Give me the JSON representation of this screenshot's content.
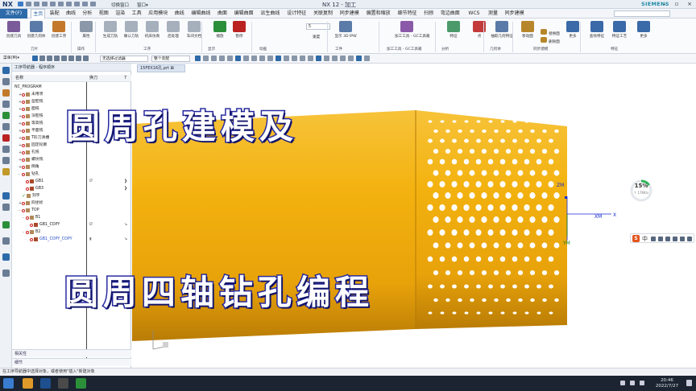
{
  "app": {
    "logo": "NX",
    "title": "NX 12 - 加工",
    "brand": "SIEMENS",
    "switch_window": "切换窗口",
    "window_menu": "窗口▾"
  },
  "menu": {
    "file": "文件(F)",
    "tabs": [
      "主页",
      "装配",
      "曲线",
      "分析",
      "视图",
      "渲染",
      "工具",
      "应用模块",
      "曲线",
      "编辑曲线",
      "曲面",
      "编辑曲面",
      "派生曲线",
      "设计特征",
      "关联复制",
      "同步建模",
      "偏置和缩放",
      "细节特征",
      "扫掠",
      "弯边曲面",
      "WCS",
      "测量",
      "同步建模"
    ]
  },
  "ribbon": {
    "buttons": [
      {
        "label": "创建刀具",
        "color": "#7b5a9a"
      },
      {
        "label": "创建几何体",
        "color": "#5a7aa8"
      },
      {
        "label": "创建工序",
        "color": "#c27a2a"
      },
      {
        "label": "属性",
        "color": "#8a98aa"
      },
      {
        "label": "生成刀轨",
        "color": "#a6b0bd"
      },
      {
        "label": "确认刀轨",
        "color": "#a6b0bd"
      },
      {
        "label": "机床仿真",
        "color": "#a6b0bd"
      },
      {
        "label": "后处理",
        "color": "#a6b0bd"
      },
      {
        "label": "车间文档",
        "color": "#a6b0bd"
      },
      {
        "label": "播放",
        "color": "#2b8f3a"
      },
      {
        "label": "暂停",
        "color": "#b22"
      },
      {
        "label": "显示 3D IPW",
        "color": "#5a7aa8"
      },
      {
        "label": "加工工具 - GC工具箱",
        "color": "#8a5aa8"
      },
      {
        "label": "特征",
        "color": "#4a9a6a"
      },
      {
        "label": "点",
        "color": "#c23a3a"
      },
      {
        "label": "抽取几何特征",
        "color": "#5a7aa8"
      },
      {
        "label": "移动面",
        "color": "#b8862a"
      },
      {
        "label": "替换面",
        "color": "#b8862a"
      },
      {
        "label": "删除面",
        "color": "#b8862a"
      },
      {
        "label": "更多",
        "color": "#3a6aa8"
      },
      {
        "label": "查找特征",
        "color": "#3a6aa8"
      },
      {
        "label": "特征工艺",
        "color": "#3a6aa8"
      },
      {
        "label": "更多",
        "color": "#3a6aa8"
      }
    ],
    "groups": [
      "刀片",
      "操作",
      "工序",
      "显示",
      "动画",
      "工件",
      "加工工具 - GC工具箱",
      "分析",
      "几何体",
      "同步建模",
      "特征"
    ],
    "speed_value": "5",
    "speed_label": "速度"
  },
  "toolbar2": {
    "menu_label": "菜单(M)▾",
    "filter": "无选择过滤器",
    "assembly": "整个装配"
  },
  "navigator": {
    "title": "工序导航器 - 程序顺序",
    "col_name": "名称",
    "col_tool": "换刀",
    "col_path": "7",
    "rows": [
      {
        "indent": 0,
        "name": "NC_PROGRAM",
        "type": "root"
      },
      {
        "indent": 1,
        "name": "未用项",
        "type": "folder",
        "exp": "+"
      },
      {
        "indent": 1,
        "name": "型腔铣",
        "type": "folder",
        "exp": "+"
      },
      {
        "indent": 1,
        "name": "面铣",
        "type": "folder",
        "exp": "+"
      },
      {
        "indent": 1,
        "name": "深腔铣",
        "type": "folder",
        "exp": "+"
      },
      {
        "indent": 1,
        "name": "等高铣",
        "type": "folder",
        "exp": "+"
      },
      {
        "indent": 1,
        "name": "平面铣",
        "type": "folder",
        "exp": "+"
      },
      {
        "indent": 1,
        "name": "T形刀清槽",
        "type": "folder",
        "exp": "+"
      },
      {
        "indent": 1,
        "name": "固定轮廓",
        "type": "folder",
        "exp": "+"
      },
      {
        "indent": 1,
        "name": "孔铣",
        "type": "folder",
        "exp": "+"
      },
      {
        "indent": 1,
        "name": "螺纹铣",
        "type": "folder",
        "exp": "+"
      },
      {
        "indent": 1,
        "name": "倒角",
        "type": "folder",
        "exp": "+"
      },
      {
        "indent": 1,
        "name": "钻孔",
        "type": "folder",
        "exp": "-"
      },
      {
        "indent": 2,
        "name": "GB1",
        "type": "op",
        "tool": "Ø",
        "mark": "❯"
      },
      {
        "indent": 2,
        "name": "GB3",
        "type": "op",
        "tool": "",
        "mark": "❯"
      },
      {
        "indent": 1,
        "name": "刻字",
        "type": "done",
        "exp": ""
      },
      {
        "indent": 1,
        "name": "四坐标",
        "type": "folder",
        "exp": "+"
      },
      {
        "indent": 1,
        "name": "TOP",
        "type": "folder",
        "exp": "-"
      },
      {
        "indent": 2,
        "name": "B1",
        "type": "folder",
        "exp": "-"
      },
      {
        "indent": 3,
        "name": "GB1_COPY",
        "type": "op",
        "tool": "Ø",
        "mark": "↘"
      },
      {
        "indent": 2,
        "name": "B2",
        "type": "folder",
        "exp": "-"
      },
      {
        "indent": 3,
        "name": "GB1_COPY_COPY",
        "type": "op",
        "tool": "▮",
        "mark": "↘"
      }
    ],
    "dependencies": "相关性",
    "details": "细节"
  },
  "graphics": {
    "doc_tab": "15FEX16孔.prt ⊠",
    "axis_zm": "ZM",
    "axis_xm": "XM",
    "axis_ym": "YM"
  },
  "overlay": {
    "caption_top": "圆周孔建模及",
    "caption_bottom": "圆周四轴钻孔编程"
  },
  "progress": {
    "percent": "15%",
    "rate": "↑ 176K/s",
    "fraction": 0.15
  },
  "ime": {
    "lang": "中"
  },
  "status": "在工序导航器中选择对象，或者使用\"插入\"新建对象",
  "clock": {
    "time": "20:46",
    "date": "2022/7/27"
  },
  "colors": {
    "cylinder": "#f2b31a",
    "hole": "#ffffff",
    "accent": "#2d6aa9",
    "caption_stroke": "#1c1f8c"
  }
}
